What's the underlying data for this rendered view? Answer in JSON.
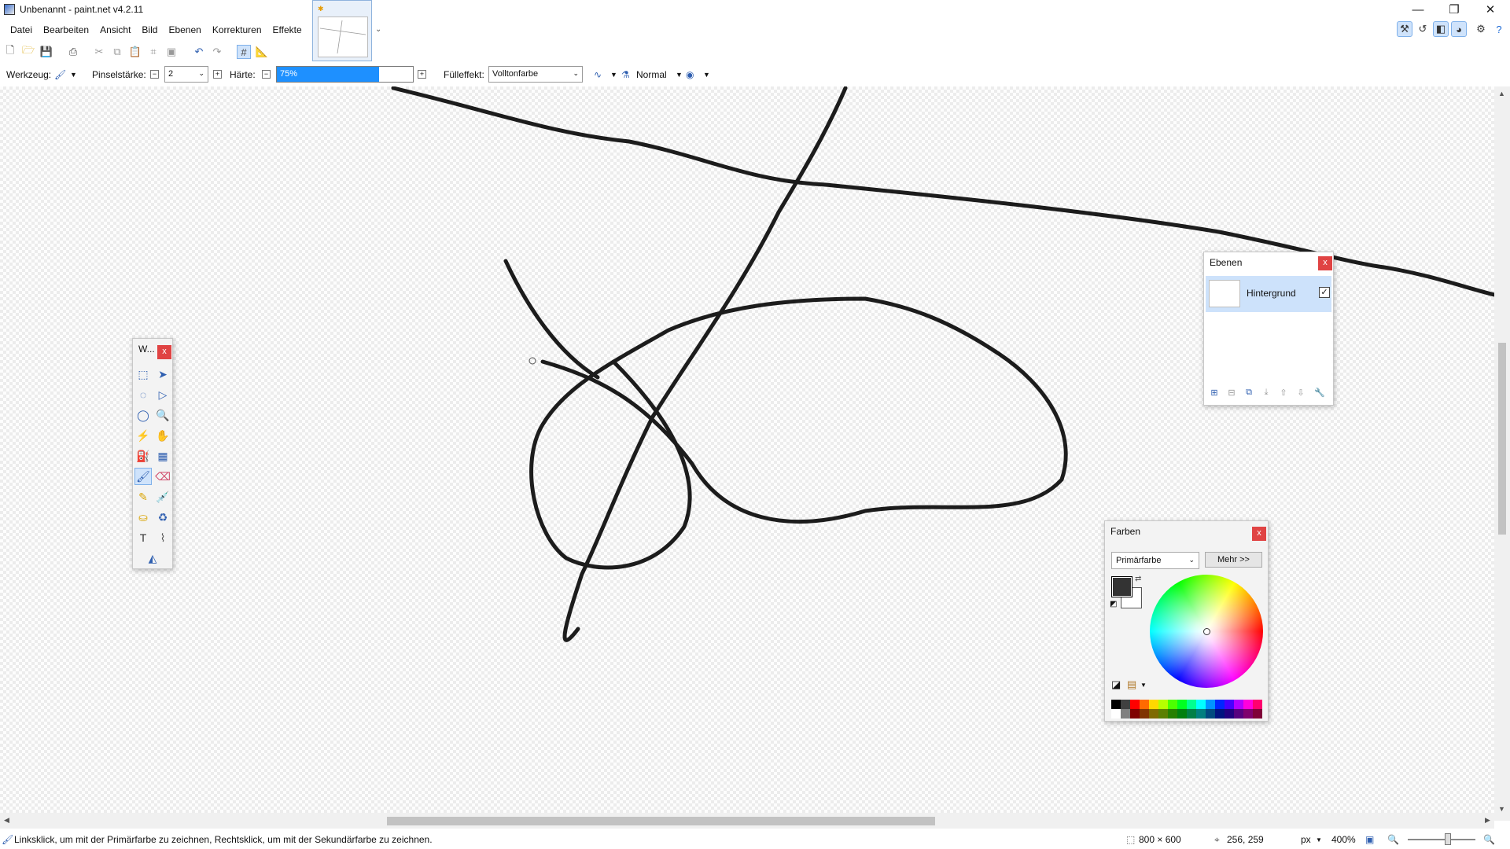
{
  "window": {
    "title": "Unbenannt - paint.net v4.2.11",
    "min_glyph": "—",
    "max_glyph": "❐",
    "close_glyph": "✕"
  },
  "menu": [
    "Datei",
    "Bearbeiten",
    "Ansicht",
    "Bild",
    "Ebenen",
    "Korrekturen",
    "Effekte"
  ],
  "options": {
    "tool_label": "Werkzeug:",
    "brush_width_label": "Pinselstärke:",
    "brush_width_value": "2",
    "hardness_label": "Härte:",
    "hardness_value": "75%",
    "hardness_fraction": 0.75,
    "fill_label": "Fülleffekt:",
    "fill_value": "Volltonfarbe",
    "blend_mode": "Normal"
  },
  "tools_panel": {
    "title": "W...",
    "close": "x"
  },
  "layers_panel": {
    "title": "Ebenen",
    "close": "x",
    "layer_name": "Hintergrund",
    "layer_visible_mark": "✓"
  },
  "colors_panel": {
    "title": "Farben",
    "close": "x",
    "mode": "Primärfarbe",
    "more_button": "Mehr >>",
    "primary_color": "#333333",
    "secondary_color": "#ffffff",
    "palette": [
      "#000000",
      "#404040",
      "#ff0000",
      "#ff6a00",
      "#ffd800",
      "#b6ff00",
      "#4cff00",
      "#00ff21",
      "#00ff90",
      "#00ffff",
      "#0094ff",
      "#0026ff",
      "#4800ff",
      "#b200ff",
      "#ff00dc",
      "#ff006e",
      "#ffffff",
      "#808080",
      "#7f0000",
      "#7f3300",
      "#7f6a00",
      "#5b7f00",
      "#267f00",
      "#007f0e",
      "#007f46",
      "#007f7f",
      "#004a7f",
      "#00137f",
      "#21007f",
      "#57007f",
      "#7f006e",
      "#7f0037"
    ]
  },
  "status": {
    "hint": "Linksklick, um mit der Primärfarbe zu zeichnen, Rechtsklick, um mit der Sekundärfarbe zu zeichnen.",
    "image_size": "800 × 600",
    "cursor_pos": "256, 259",
    "unit": "px",
    "zoom": "400%"
  }
}
